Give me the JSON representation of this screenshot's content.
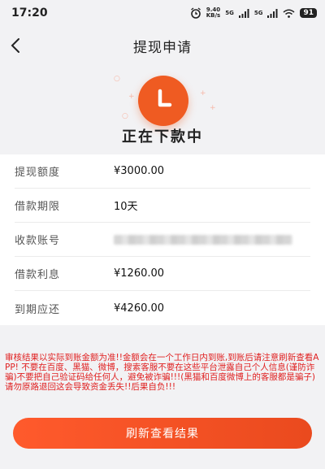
{
  "status_bar": {
    "time": "17:20",
    "speed_value": "9.40",
    "speed_unit": "KB/s",
    "signal1": "5G",
    "signal2": "5G",
    "battery": "91"
  },
  "nav": {
    "title": "提现申请"
  },
  "hero": {
    "status_text": "正在下款中"
  },
  "details": [
    {
      "label": "提现额度",
      "value": "¥3000.00"
    },
    {
      "label": "借款期限",
      "value": "10天"
    },
    {
      "label": "收款账号",
      "value": ""
    },
    {
      "label": "借款利息",
      "value": "¥1260.00"
    },
    {
      "label": "到期应还",
      "value": "¥4260.00"
    }
  ],
  "notice": "审核结果以实际到账金额为准!!金额会在一个工作日内到账,到账后请注意刷新查看APP! 不要在百度、黑猫、微博，搜索客服不要在这些平台泄露自己个人信息(谨防诈骗)不要把自己验证码给任何人，避免被诈骗!!!(黑猫和百度微博上的客服都是骗子)请勿原路退回这会导致资金丢失!!后果自负!!!",
  "actions": {
    "refresh_label": "刷新查看结果"
  },
  "colors": {
    "accent": "#ef5b22",
    "warning": "#e02020"
  }
}
